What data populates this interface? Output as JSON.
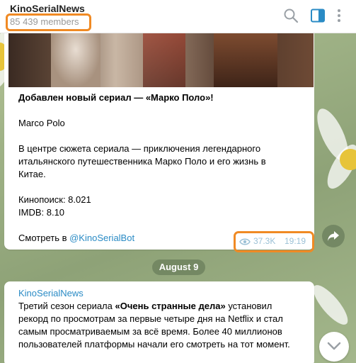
{
  "header": {
    "channel_title": "KinoSerialNews",
    "members": "85 439 members"
  },
  "icons": {
    "search": "search-icon",
    "sidebar": "sidebar-toggle-icon",
    "more": "more-vertical-icon",
    "views": "eye-icon",
    "share": "share-icon",
    "scroll": "chevron-down-icon"
  },
  "colors": {
    "accent": "#2a8bc5",
    "highlight": "#f08a24"
  },
  "message1": {
    "title": "Добавлен новый сериал — «Марко Поло»!",
    "original_title": "Marco Polo",
    "description_lines": [
      "В центре сюжета сериала — приключения легендарного",
      "итальянского путешественника Марко Поло и его жизнь в",
      "Китае."
    ],
    "kinopoisk": "Кинопоиск: 8.021",
    "imdb": "IMDB: 8.10",
    "watch_prefix": "Смотреть в ",
    "watch_link": "@KinoSerialBot",
    "views": "37.3K",
    "time": "19:19"
  },
  "date_separator": "August 9",
  "message2": {
    "author": "KinoSerialNews",
    "line1_prefix": "Третий сезон сериала ",
    "line1_bold": "«Очень странные дела»",
    "line1_suffix": " установил",
    "line2": "рекорд по просмотрам за первые четыре дня на Netflix и стал",
    "line3": "самым просматриваемым за всё время. Более 40 миллионов",
    "line4": "пользователей платформы начали его смотреть на тот момент."
  }
}
